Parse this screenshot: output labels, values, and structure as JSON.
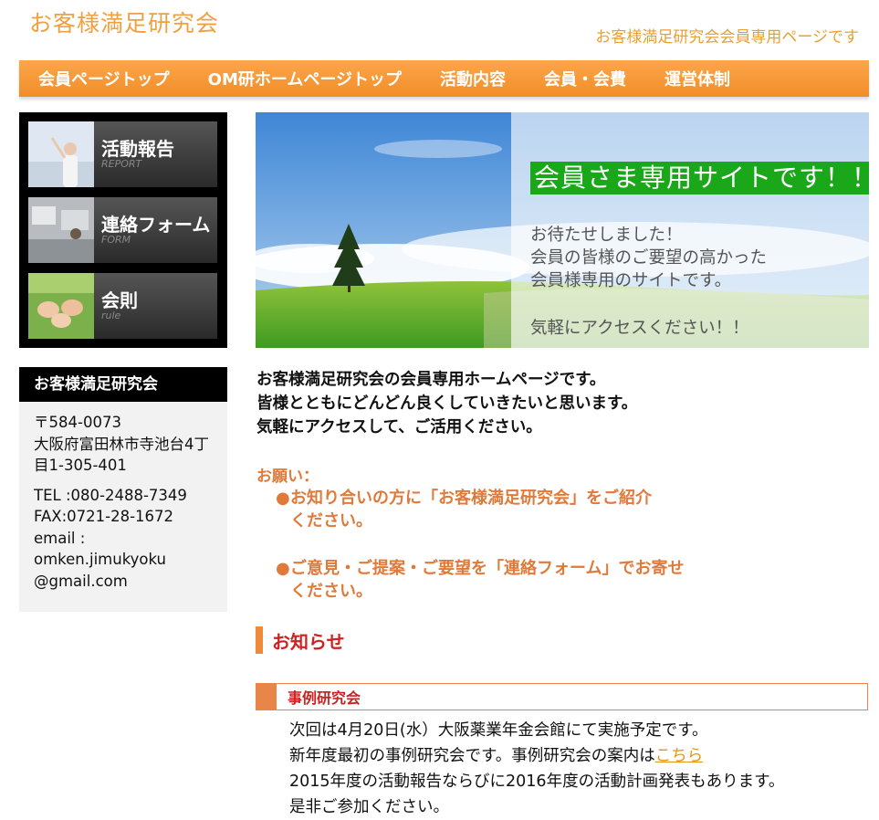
{
  "header": {
    "title": "お客様満足研究会",
    "subtitle": "お客様満足研究会会員専用ページです"
  },
  "nav": [
    {
      "label": "会員ページトップ"
    },
    {
      "label": "OM研ホームページトップ"
    },
    {
      "label": "活動内容"
    },
    {
      "label": "会員・会費"
    },
    {
      "label": "運営体制"
    }
  ],
  "sidebar_menu": [
    {
      "label": "活動報告",
      "sub": "REPORT"
    },
    {
      "label": "連絡フォーム",
      "sub": "FORM"
    },
    {
      "label": "会則",
      "sub": "rule"
    }
  ],
  "info": {
    "heading": "お客様満足研究会",
    "postal": "〒584-0073",
    "address_1": "大阪府富田林市寺池台4丁",
    "address_2": "目1-305-401",
    "tel": "TEL :080-2488-7349",
    "fax": "FAX:0721-28-1672",
    "email_label": "email :",
    "email_1": "omken.jimukyoku",
    "email_2": "@gmail.com"
  },
  "banner": {
    "headline": "会員さま専用サイトです！！",
    "line1": "お待たせしました！",
    "line2": "会員の皆様のご要望の高かった",
    "line3": "会員様専用のサイトです。",
    "line4": "気軽にアクセスください！！"
  },
  "intro": {
    "line1": "お客様満足研究会の会員専用ホームページです。",
    "line2": "皆様とともにどんどん良くしていきたいと思います。",
    "line3": "気軽にアクセスして、ご活用ください。"
  },
  "request": {
    "label": "お願い：",
    "bullet": "●",
    "item1_line1": "お知り合いの方に「お客様満足研究会」をご紹介",
    "item1_line2": "ください。",
    "item2_line1": "ご意見・ご提案・ご要望を「連絡フォーム」でお寄せ",
    "item2_line2": "ください。"
  },
  "notice": {
    "title": "お知らせ"
  },
  "case_study": {
    "title": "事例研究会",
    "line1": "次回は4月20日(水）大阪薬業年金会館にて実施予定です。",
    "line2_text": "新年度最初の事例研究会です。事例研究会の案内は",
    "line2_link": "こちら",
    "line3": "2015年度の活動報告ならびに2016年度の活動計画発表もあります。",
    "line4": "是非ご参加ください。"
  },
  "colors": {
    "nav_orange": "#f59a3a",
    "title_orange": "#f0a040",
    "accent_red": "#cc2222",
    "request_orange": "#e07a3a",
    "banner_green": "#1aa81a"
  }
}
